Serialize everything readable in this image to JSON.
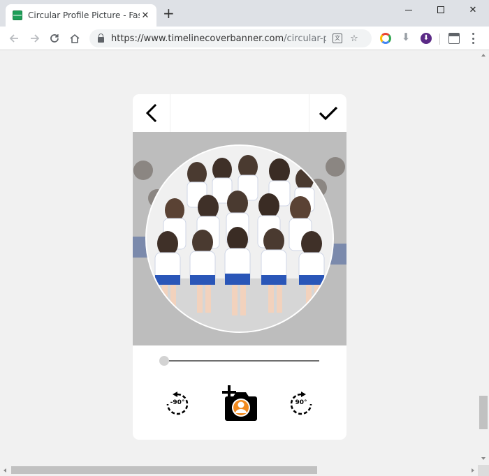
{
  "browser": {
    "tab_title": "Circular Profile Picture - Fast Or",
    "tab_close": "✕",
    "new_tab": "+",
    "url_host": "https://www.timelinecoverbanner.com",
    "url_path": "/circular-pr...",
    "window_close": "✕"
  },
  "editor": {
    "zoom_fraction": 0,
    "rotate_left_label": "-90°",
    "rotate_right_label": "90°"
  },
  "colors": {
    "crop_background": "#a7a7a7",
    "circle_border": "#ffffff",
    "uniform_blue": "#2a56b8"
  }
}
